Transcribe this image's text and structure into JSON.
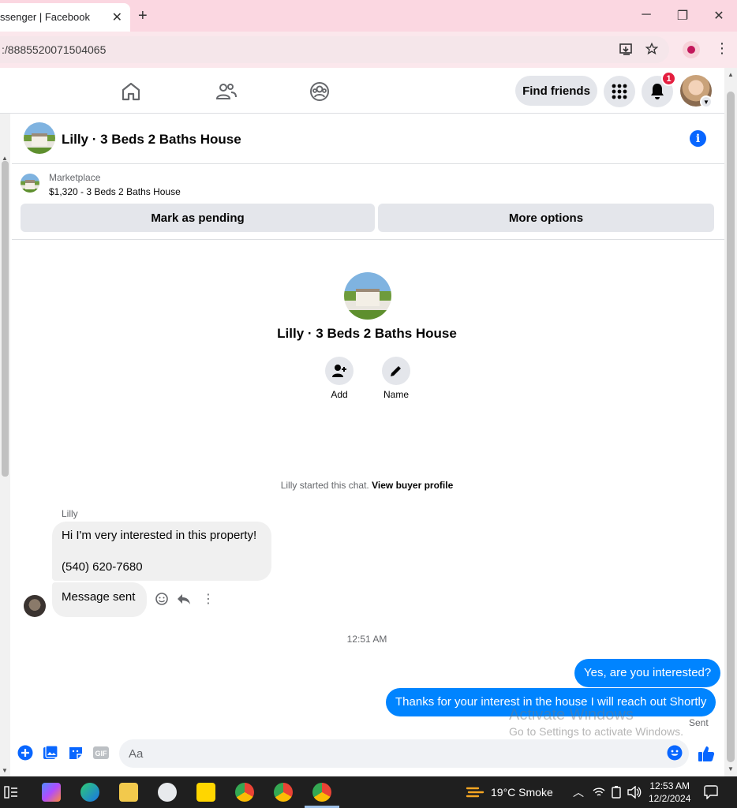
{
  "browser": {
    "tab_title": "ssenger | Facebook",
    "tab_close": "✕",
    "new_tab": "+",
    "url": ":/8885520071504065",
    "window_min": "─",
    "window_restore": "❐",
    "window_close": "✕"
  },
  "facebook": {
    "find_friends_label": "Find friends",
    "notification_count": "1"
  },
  "chat": {
    "title": "Lilly · 3 Beds 2 Baths House",
    "marketplace_label": "Marketplace",
    "listing": "$1,320 - 3 Beds 2 Baths House",
    "mark_pending_label": "Mark as pending",
    "more_options_label": "More options",
    "intro_title": "Lilly · 3 Beds 2 Baths House",
    "add_label": "Add",
    "name_label": "Name",
    "started_text": "Lilly started this chat.",
    "buyer_profile_link": "View buyer profile"
  },
  "messages": {
    "sender": "Lilly",
    "incoming_1_line1": "Hi I'm very interested in this property!",
    "incoming_1_line2": "(540) 620-7680",
    "incoming_2": "Message sent",
    "timestamp": "12:51 AM",
    "outgoing_1": "Yes, are you interested?",
    "outgoing_2": "Thanks for your interest in the house I will reach out Shortly",
    "status": "Sent"
  },
  "watermark": {
    "line1": "Activate Windows",
    "line2": "Go to Settings to activate Windows."
  },
  "composer": {
    "placeholder": "Aa",
    "gif_label": "GIF"
  },
  "taskbar": {
    "weather": "19°C  Smoke",
    "time": "12:53 AM",
    "date": "12/2/2024"
  },
  "colors": {
    "messenger_blue": "#0084ff",
    "fb_blue": "#0866ff",
    "badge_red": "#e41e3f"
  }
}
